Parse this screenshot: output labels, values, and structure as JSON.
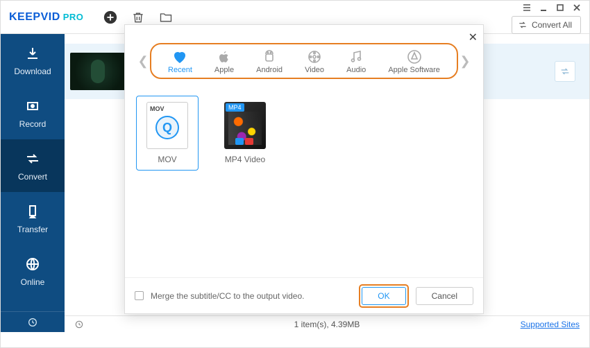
{
  "window": {
    "logo1": "KEEPVID",
    "logo2": "PRO",
    "convert_all": "Convert All"
  },
  "sidebar": {
    "items": [
      {
        "label": "Download"
      },
      {
        "label": "Record"
      },
      {
        "label": "Convert"
      },
      {
        "label": "Transfer"
      },
      {
        "label": "Online"
      }
    ]
  },
  "statusbar": {
    "count_text": "1 item(s), 4.39MB",
    "supported": "Supported Sites"
  },
  "modal": {
    "categories": [
      {
        "label": "Recent"
      },
      {
        "label": "Apple"
      },
      {
        "label": "Android"
      },
      {
        "label": "Video"
      },
      {
        "label": "Audio"
      },
      {
        "label": "Apple Software"
      }
    ],
    "formats": [
      {
        "label": "MOV"
      },
      {
        "label": "MP4 Video"
      }
    ],
    "merge_label": "Merge the subtitle/CC to the output video.",
    "ok": "OK",
    "cancel": "Cancel"
  }
}
